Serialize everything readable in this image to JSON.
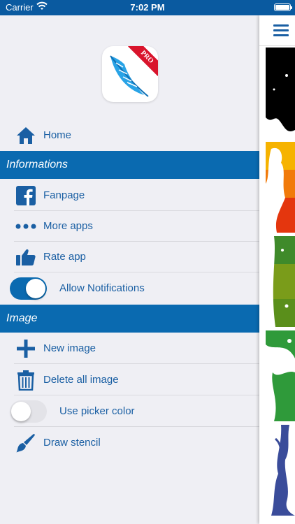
{
  "status_bar": {
    "carrier": "Carrier",
    "time": "7:02 PM"
  },
  "app": {
    "badge": "PRO"
  },
  "menu": {
    "home_label": "Home",
    "section_informations": "Informations",
    "fanpage_label": "Fanpage",
    "more_apps_label": "More apps",
    "rate_app_label": "Rate app",
    "allow_notifications_label": "Allow Notifications",
    "allow_notifications_on": true,
    "section_image": "Image",
    "new_image_label": "New image",
    "delete_all_label": "Delete all image",
    "use_picker_label": "Use picker color",
    "use_picker_on": false,
    "draw_stencil_label": "Draw stencil"
  },
  "colors": {
    "accent": "#0a6ab0",
    "icon": "#1a5fa3",
    "menu_bg": "#efeff4"
  },
  "icons": [
    "home-icon",
    "facebook-icon",
    "more-dots-icon",
    "thumbs-up-icon",
    "plus-icon",
    "trash-icon",
    "brush-icon",
    "hamburger-icon"
  ]
}
